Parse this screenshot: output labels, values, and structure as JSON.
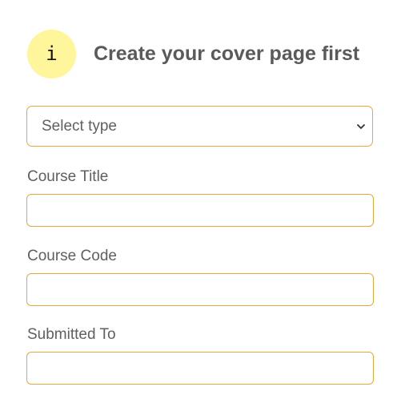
{
  "header": {
    "icon": "info-icon",
    "icon_glyph": "i",
    "title": "Create your cover page first",
    "badge_color": "#fff59a"
  },
  "type_select": {
    "selected": "Select type",
    "icon": "chevron-down-icon",
    "border_color": "#e6a93a"
  },
  "fields": {
    "course_title": {
      "label": "Course Title",
      "value": ""
    },
    "course_code": {
      "label": "Course Code",
      "value": ""
    },
    "submitted_to": {
      "label": "Submitted To",
      "value": ""
    }
  }
}
